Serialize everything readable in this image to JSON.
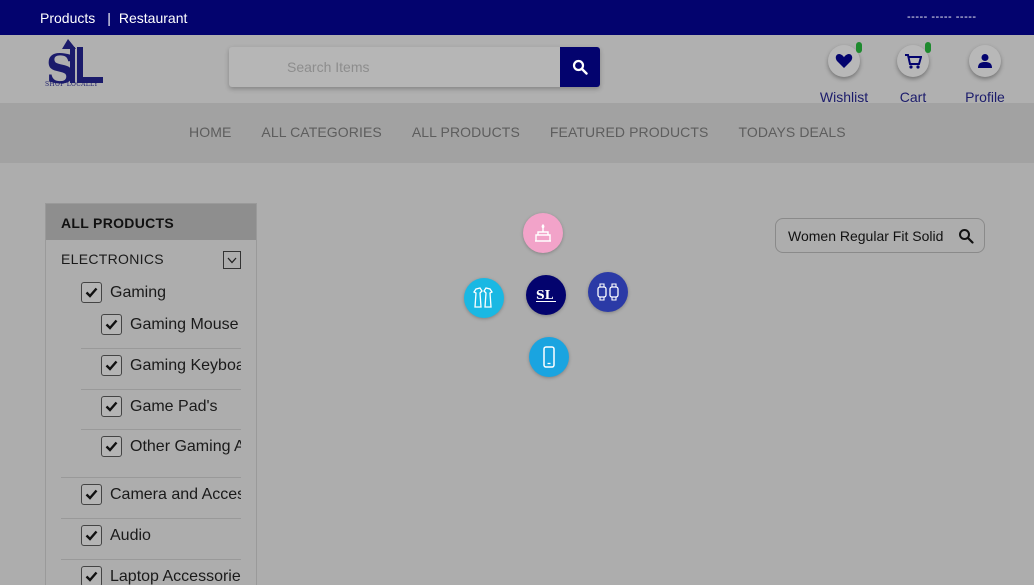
{
  "topbar": {
    "link_products": "Products",
    "separator": "|",
    "link_restaurant": "Restaurant",
    "right_text": "----- ----- -----",
    "color": "#03036e"
  },
  "logo": {
    "letters": "SL",
    "tagline": "SHOP LOCALLY"
  },
  "search": {
    "placeholder": "Search Items",
    "value": ""
  },
  "header_icons": [
    {
      "label": "Wishlist",
      "icon": "heart-icon"
    },
    {
      "label": "Cart",
      "icon": "cart-icon"
    },
    {
      "label": "Profile",
      "icon": "user-icon"
    }
  ],
  "nav": [
    "HOME",
    "ALL CATEGORIES",
    "ALL PRODUCTS",
    "FEATURED PRODUCTS",
    "TODAYS DEALS"
  ],
  "sidebar": {
    "title": "ALL PRODUCTS",
    "category": "ELECTRONICS",
    "items": [
      {
        "label": "Gaming",
        "checked": true,
        "level": 1
      },
      {
        "label": "Gaming Mouse",
        "checked": true,
        "level": 2
      },
      {
        "label": "Gaming Keyboa",
        "checked": true,
        "level": 2
      },
      {
        "label": "Game Pad's",
        "checked": true,
        "level": 2
      },
      {
        "label": "Other Gaming A",
        "checked": true,
        "level": 2
      },
      {
        "label": "Camera and Acces",
        "checked": true,
        "level": 1
      },
      {
        "label": "Audio",
        "checked": true,
        "level": 1
      },
      {
        "label": "Laptop Accessorie",
        "checked": true,
        "level": 1
      }
    ]
  },
  "bubbles": [
    {
      "name": "food-category",
      "icon": "cake-icon",
      "color": "#f2a3c9"
    },
    {
      "name": "fashion-category",
      "icon": "clothing-icon",
      "color": "#1ab8e3"
    },
    {
      "name": "center-logo",
      "icon": "shop-logo-icon",
      "color": "#03036e"
    },
    {
      "name": "watches-category",
      "icon": "watch-icon",
      "color": "#2b3aa6"
    },
    {
      "name": "mobile-category",
      "icon": "phone-icon",
      "color": "#1aa4e0"
    }
  ],
  "product_search": {
    "value": "Women Regular Fit Solid"
  }
}
